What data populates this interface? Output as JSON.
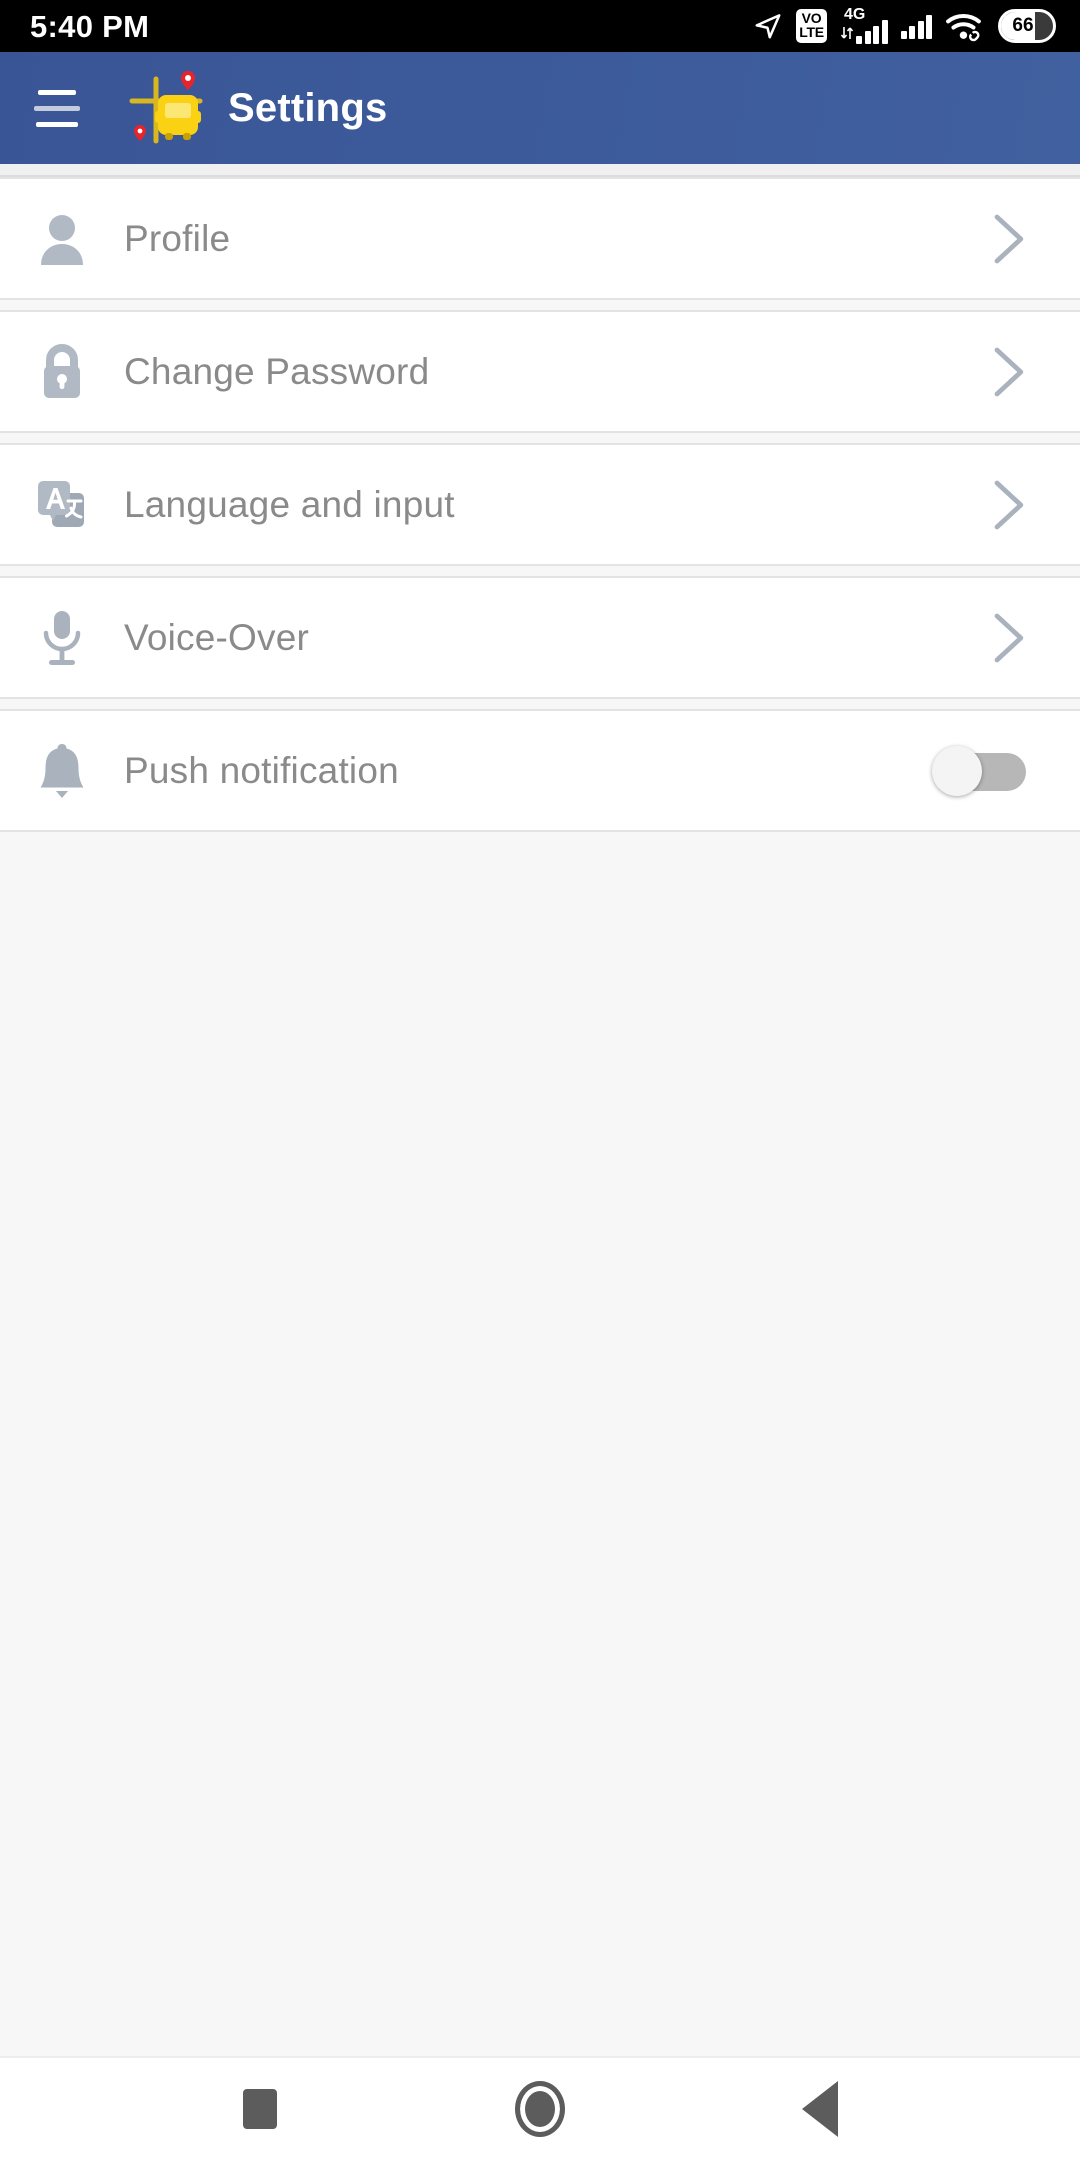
{
  "status_bar": {
    "time": "5:40 PM",
    "icons": {
      "location": "location-arrow-icon",
      "volte_top": "VO",
      "volte_bottom": "LTE",
      "network_label": "4G",
      "wifi": "wifi-icon",
      "battery_level": "66"
    }
  },
  "app_bar": {
    "menu_icon": "hamburger-menu-icon",
    "logo": "school-bus-map-logo",
    "title": "Settings",
    "background_color": "#3c5a9a",
    "title_color": "#ffffff"
  },
  "settings_list": {
    "items": [
      {
        "label": "Profile",
        "icon": "person-icon",
        "control": "chevron"
      },
      {
        "label": "Change Password",
        "icon": "lock-icon",
        "control": "chevron"
      },
      {
        "label": "Language and input",
        "icon": "translate-icon",
        "control": "chevron"
      },
      {
        "label": "Voice-Over",
        "icon": "microphone-icon",
        "control": "chevron"
      },
      {
        "label": "Push notification",
        "icon": "bell-icon",
        "control": "toggle",
        "toggle_state": "off"
      }
    ],
    "row_background": "#ffffff",
    "label_color": "#8a8a8a",
    "icon_color": "#b0b9c4"
  },
  "nav_bar": {
    "recents_label": "recents-square",
    "home_label": "home-circle",
    "back_label": "back-triangle",
    "color": "#5c5c5c"
  }
}
